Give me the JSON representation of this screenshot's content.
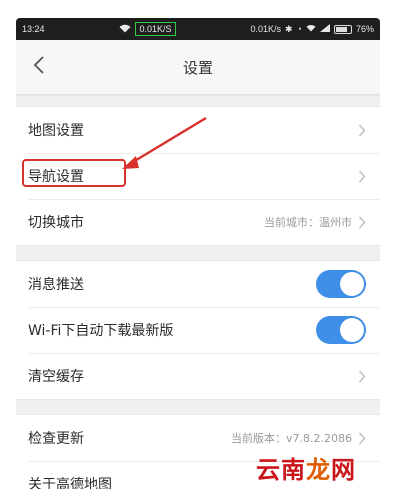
{
  "status_bar": {
    "time": "13:24",
    "net_speed_center": "0.01K/S",
    "net_speed_right": "0.01K/s",
    "battery": "76%"
  },
  "nav": {
    "title": "设置",
    "back_icon": "chevron-left-icon"
  },
  "groups": [
    {
      "items": [
        {
          "label": "地图设置",
          "value": "",
          "control": "chevron"
        },
        {
          "label": "导航设置",
          "value": "",
          "control": "chevron",
          "highlighted": true
        },
        {
          "label": "切换城市",
          "value": "当前城市：温州市",
          "control": "chevron"
        }
      ]
    },
    {
      "items": [
        {
          "label": "消息推送",
          "control": "toggle",
          "on": true
        },
        {
          "label": "Wi-Fi下自动下载最新版",
          "control": "toggle",
          "on": true
        },
        {
          "label": "清空缓存",
          "value": "",
          "control": "chevron"
        }
      ]
    },
    {
      "items": [
        {
          "label": "检查更新",
          "value": "当前版本：v7.8.2.2086",
          "control": "chevron"
        },
        {
          "label": "关于高德地图",
          "value": "",
          "control": "none"
        }
      ]
    }
  ],
  "annotation": {
    "color": "#d8322f"
  },
  "watermark": {
    "chars": [
      "云",
      "南",
      "龙",
      "网"
    ]
  },
  "colors": {
    "toggle_on": "#3f8ee8",
    "page_bg": "#f3f3f3"
  }
}
